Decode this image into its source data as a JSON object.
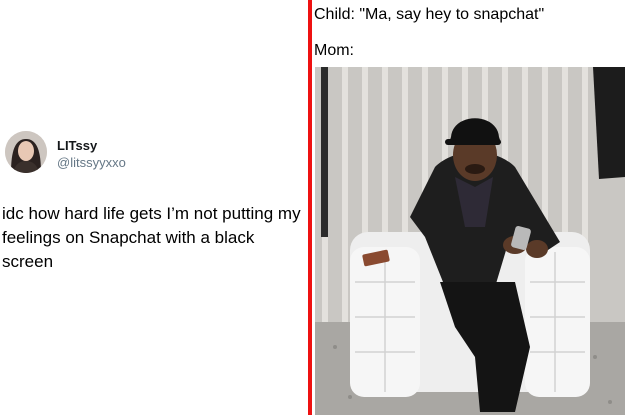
{
  "tweet": {
    "display_name": "LITssy",
    "handle": "@litssyyxxo",
    "text": "idc how hard life gets I’m not putting my feelings on Snapchat with a black screen"
  },
  "meme": {
    "line1": "Child: \"Ma, say hey to snapchat\"",
    "line2": "Mom:"
  },
  "colors": {
    "divider": "#ee1111"
  }
}
